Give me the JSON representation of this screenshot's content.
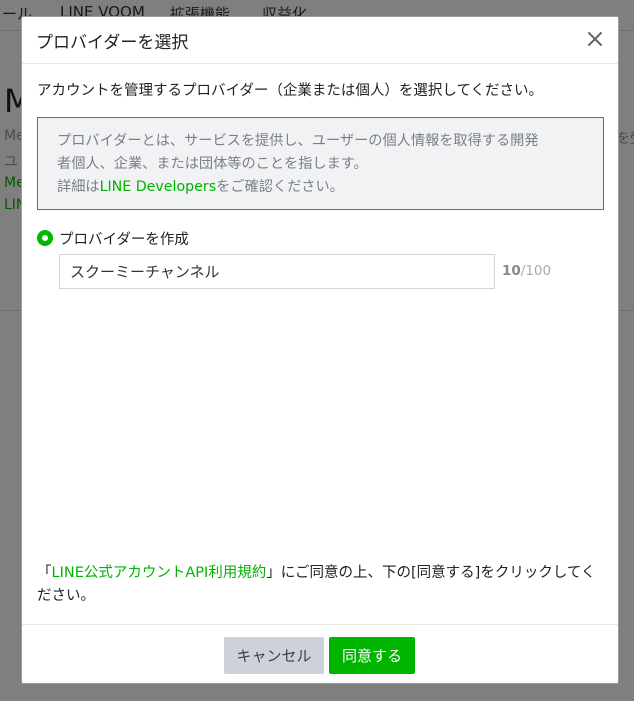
{
  "background": {
    "nav_items": [
      "ール",
      "LINE VOOM",
      "拡張機能",
      "収益化"
    ],
    "heading": "M",
    "line1": "Me",
    "line2": "ユ",
    "line3": "Me",
    "line4": "LIN",
    "right_fragment": "を受"
  },
  "modal": {
    "title": "プロバイダーを選択",
    "close_icon": "close-icon",
    "description": "アカウントを管理するプロバイダー（企業または個人）を選択してください。",
    "info": {
      "line1": "プロバイダーとは、サービスを提供し、ユーザーの個人情報を取得する開発",
      "line2": "者個人、企業、または団体等のことを指します。",
      "line3_prefix": "詳細は",
      "line3_link": "LINE Developers",
      "line3_suffix": "をご確認ください。"
    },
    "radio_label": "プロバイダーを作成",
    "provider_name_value": "スクーミーチャンネル",
    "counter_current": "10",
    "counter_max": "/100",
    "terms": {
      "open_quote": "「",
      "link": "LINE公式アカウントAPI利用規約",
      "text": "」にご同意の上、下の[同意する]をクリックしてください。"
    },
    "cancel_label": "キャンセル",
    "agree_label": "同意する"
  },
  "colors": {
    "accent_green": "#00b400",
    "cancel_bg": "#cdd2d9",
    "info_bg": "#f1f2f4"
  }
}
